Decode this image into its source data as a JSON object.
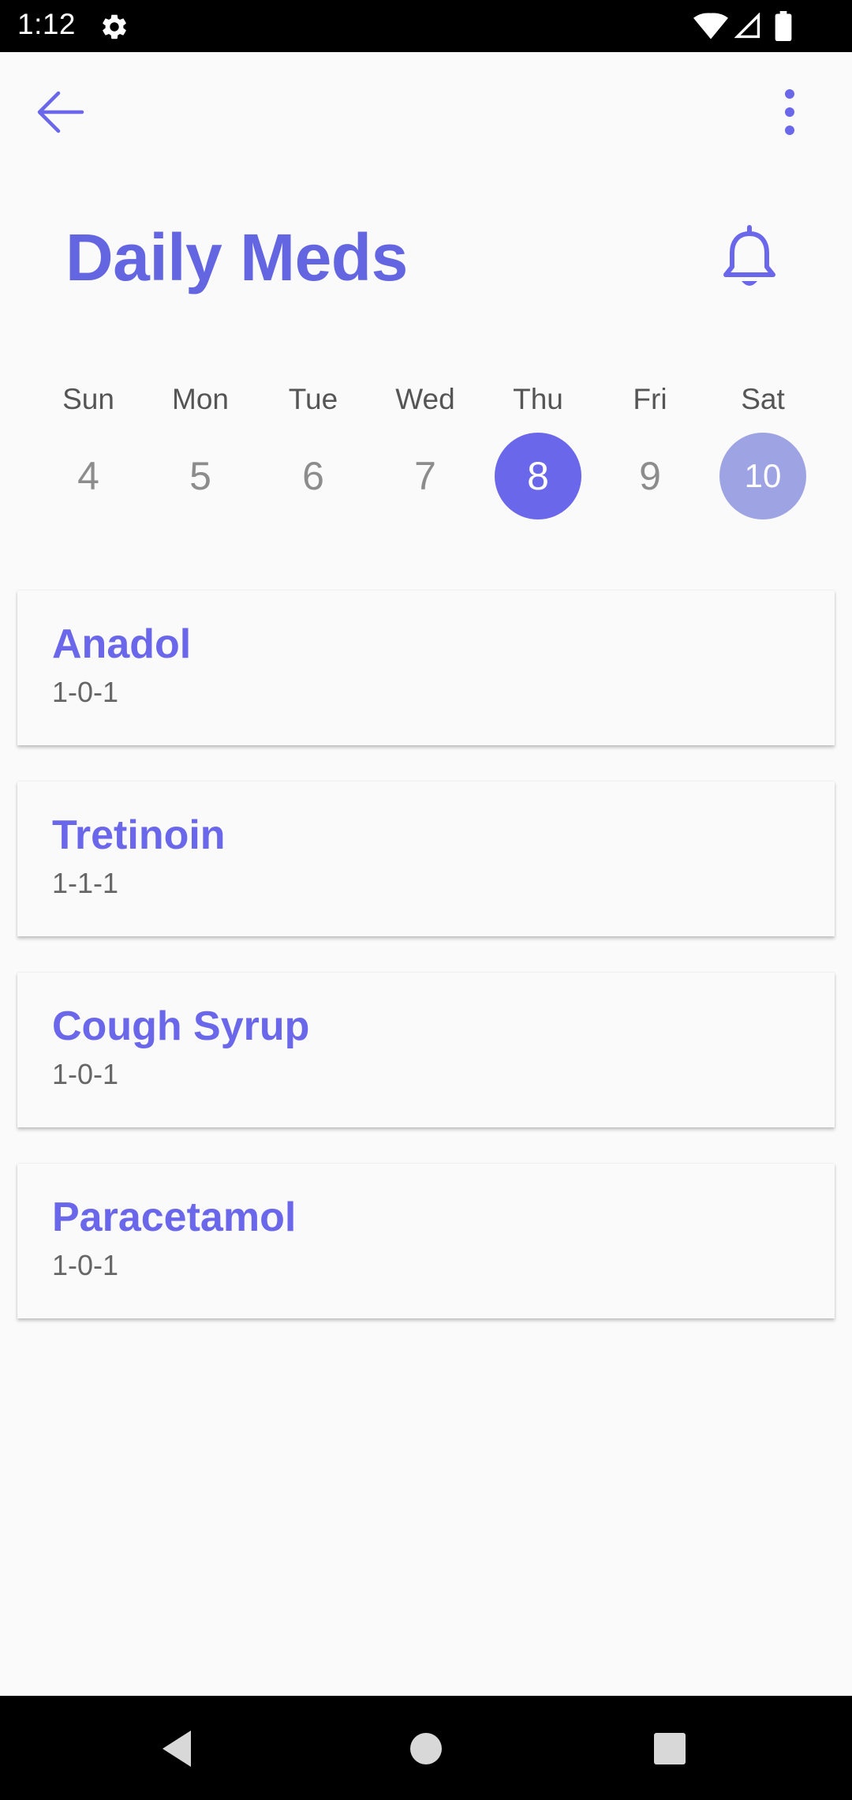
{
  "status_bar": {
    "time": "1:12",
    "icons": [
      "settings-gear-icon",
      "wifi-icon",
      "cell-signal-icon",
      "battery-icon"
    ]
  },
  "app_bar": {
    "back_icon": "arrow-left-icon",
    "menu_icon": "more-vert-icon"
  },
  "header": {
    "title": "Daily Meds",
    "bell_icon": "bell-icon"
  },
  "week": {
    "days": [
      {
        "name": "Sun",
        "date": "4",
        "state": "normal"
      },
      {
        "name": "Mon",
        "date": "5",
        "state": "normal"
      },
      {
        "name": "Tue",
        "date": "6",
        "state": "normal"
      },
      {
        "name": "Wed",
        "date": "7",
        "state": "normal"
      },
      {
        "name": "Thu",
        "date": "8",
        "state": "selected"
      },
      {
        "name": "Fri",
        "date": "9",
        "state": "normal"
      },
      {
        "name": "Sat",
        "date": "10",
        "state": "today"
      }
    ]
  },
  "medications": [
    {
      "name": "Anadol",
      "dose": "1-0-1"
    },
    {
      "name": "Tretinoin",
      "dose": "1-1-1"
    },
    {
      "name": "Cough Syrup",
      "dose": "1-0-1"
    },
    {
      "name": "Paracetamol",
      "dose": "1-0-1"
    }
  ],
  "nav_bar": {
    "icons": [
      "nav-back-icon",
      "nav-home-icon",
      "nav-recents-icon"
    ]
  },
  "colors": {
    "accent": "#6b67ea",
    "today_bg": "#9ea4e3",
    "background": "#fafafa",
    "day_number_gray": "#8c8c8c"
  }
}
